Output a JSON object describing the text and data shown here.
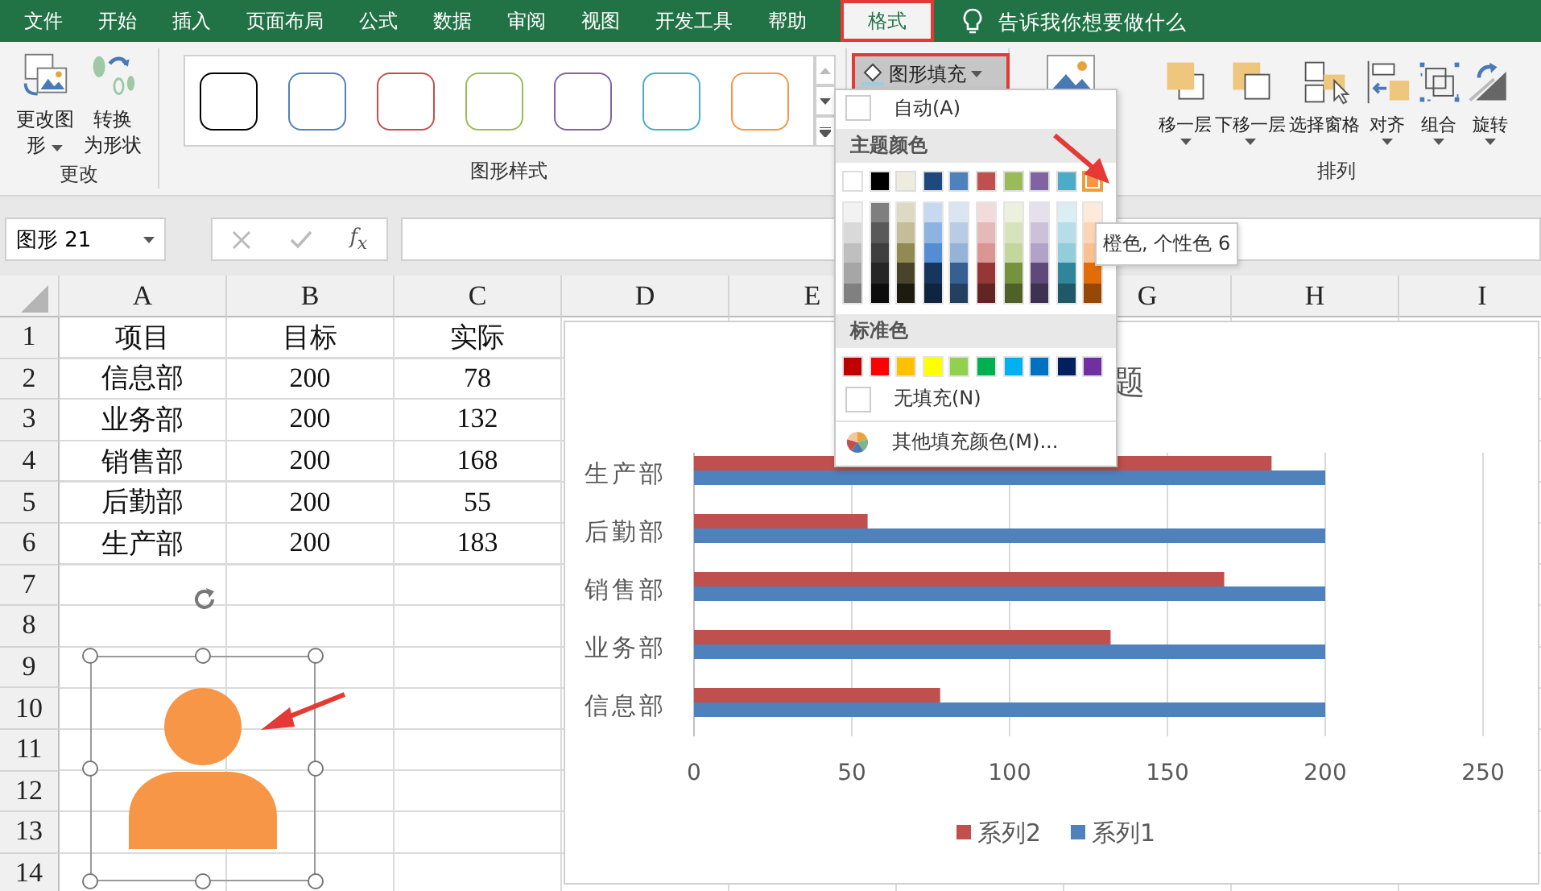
{
  "menu_tabs": [
    {
      "label": "文件",
      "selected": false
    },
    {
      "label": "开始",
      "selected": false
    },
    {
      "label": "插入",
      "selected": false
    },
    {
      "label": "页面布局",
      "selected": false
    },
    {
      "label": "公式",
      "selected": false
    },
    {
      "label": "数据",
      "selected": false
    },
    {
      "label": "审阅",
      "selected": false
    },
    {
      "label": "视图",
      "selected": false
    },
    {
      "label": "开发工具",
      "selected": false
    },
    {
      "label": "帮助",
      "selected": false
    },
    {
      "label": "格式",
      "selected": true
    }
  ],
  "tell_me": {
    "placeholder": "告诉我你想要做什么"
  },
  "ribbon": {
    "change_group": {
      "label": "更改",
      "buttons": [
        {
          "kind": "change",
          "lines": [
            "更改图",
            "形"
          ],
          "dropdown": true
        },
        {
          "kind": "convert",
          "lines": [
            "转换",
            "为形状"
          ],
          "dropdown": false
        }
      ]
    },
    "styles_group": {
      "label": "图形样式",
      "styles": [
        {
          "color": "#000000"
        },
        {
          "color": "#4f81bd"
        },
        {
          "color": "#c0504d"
        },
        {
          "color": "#9bbb59"
        },
        {
          "color": "#8064a2"
        },
        {
          "color": "#4bacc6"
        },
        {
          "color": "#f79646"
        }
      ]
    },
    "fill_button": {
      "label": "图形填充",
      "expanded": true
    },
    "arrange_group": {
      "label": "排列",
      "buttons": [
        {
          "kind": "forward",
          "label": "移一层",
          "dropdown": true
        },
        {
          "kind": "backward",
          "label": "下移一层",
          "dropdown": true
        },
        {
          "kind": "pane",
          "label": "选择窗格",
          "dropdown": false
        },
        {
          "kind": "align",
          "label": "对齐",
          "dropdown": true
        },
        {
          "kind": "group",
          "label": "组合",
          "dropdown": true
        },
        {
          "kind": "rotate",
          "label": "旋转",
          "dropdown": true
        }
      ]
    }
  },
  "formula_bar": {
    "name_box": "图形 21",
    "fx": "f$_{x}$"
  },
  "sheet": {
    "columns": [
      {
        "label": "A"
      },
      {
        "label": "B"
      },
      {
        "label": "C"
      },
      {
        "label": "D"
      },
      {
        "label": "E"
      },
      {},
      {
        "label": "G"
      },
      {
        "label": "H"
      },
      {
        "label": "I"
      }
    ],
    "rows": [
      "1",
      "2",
      "3",
      "4",
      "5",
      "6",
      "7",
      "8",
      "9",
      "10",
      "11",
      "12",
      "13",
      "14"
    ],
    "cells": [
      [
        "项目",
        "目标",
        "实际"
      ],
      [
        "信息部",
        "200",
        "78"
      ],
      [
        "业务部",
        "200",
        "132"
      ],
      [
        "销售部",
        "200",
        "168"
      ],
      [
        "后勤部",
        "200",
        "55"
      ],
      [
        "生产部",
        "200",
        "183"
      ]
    ]
  },
  "chart": {
    "title": "题",
    "chart_data": {
      "type": "bar",
      "orientation": "horizontal",
      "categories": [
        "生产部",
        "后勤部",
        "销售部",
        "业务部",
        "信息部"
      ],
      "series": [
        {
          "name": "系列1",
          "color": "#4f81bd",
          "values": [
            200,
            200,
            200,
            200,
            200
          ]
        },
        {
          "name": "系列2",
          "color": "#c0504d",
          "values": [
            183,
            55,
            168,
            132,
            78
          ]
        }
      ],
      "xlim": [
        0,
        250
      ],
      "xticks": [
        0,
        50,
        100,
        150,
        200,
        250
      ],
      "grid": true,
      "legend": "bottom"
    }
  },
  "shape": {
    "kind": "person",
    "color": "#f79646",
    "selected": true
  },
  "dropdown": {
    "auto": "自动(A)",
    "theme_header": "主题颜色",
    "theme_colors": [
      {
        "color": "#ffffff",
        "selected": false,
        "shades": [
          {
            "color": "#f2f2f2"
          },
          {
            "color": "#d9d9d9"
          },
          {
            "color": "#bfbfbf"
          },
          {
            "color": "#a6a6a6"
          },
          {
            "color": "#808080"
          }
        ]
      },
      {
        "color": "#000000",
        "selected": false,
        "shades": [
          {
            "color": "#7f7f7f"
          },
          {
            "color": "#595959"
          },
          {
            "color": "#3f3f3f"
          },
          {
            "color": "#262626"
          },
          {
            "color": "#0d0d0d"
          }
        ]
      },
      {
        "color": "#eeece1",
        "selected": false,
        "shades": [
          {
            "color": "#ddd9c3"
          },
          {
            "color": "#c4bd97"
          },
          {
            "color": "#938953"
          },
          {
            "color": "#494429"
          },
          {
            "color": "#1d1b10"
          }
        ]
      },
      {
        "color": "#1f497d",
        "selected": false,
        "shades": [
          {
            "color": "#c6d9f0"
          },
          {
            "color": "#8db3e2"
          },
          {
            "color": "#548dd4"
          },
          {
            "color": "#17365d"
          },
          {
            "color": "#0f243e"
          }
        ]
      },
      {
        "color": "#4f81bd",
        "selected": false,
        "shades": [
          {
            "color": "#dbe5f1"
          },
          {
            "color": "#b8cce4"
          },
          {
            "color": "#95b3d7"
          },
          {
            "color": "#366092"
          },
          {
            "color": "#244061"
          }
        ]
      },
      {
        "color": "#c0504d",
        "selected": false,
        "shades": [
          {
            "color": "#f2dcdb"
          },
          {
            "color": "#e5b9b7"
          },
          {
            "color": "#d99694"
          },
          {
            "color": "#953734"
          },
          {
            "color": "#632423"
          }
        ]
      },
      {
        "color": "#9bbb59",
        "selected": false,
        "shades": [
          {
            "color": "#ebf1dd"
          },
          {
            "color": "#d7e3bc"
          },
          {
            "color": "#c3d69b"
          },
          {
            "color": "#76923c"
          },
          {
            "color": "#4f6128"
          }
        ]
      },
      {
        "color": "#8064a2",
        "selected": false,
        "shades": [
          {
            "color": "#e5e0ec"
          },
          {
            "color": "#ccc1d9"
          },
          {
            "color": "#b2a2c7"
          },
          {
            "color": "#5f497a"
          },
          {
            "color": "#3f3151"
          }
        ]
      },
      {
        "color": "#4bacc6",
        "selected": false,
        "shades": [
          {
            "color": "#dbeef3"
          },
          {
            "color": "#b7dde8"
          },
          {
            "color": "#92cddc"
          },
          {
            "color": "#31859b"
          },
          {
            "color": "#205867"
          }
        ]
      },
      {
        "color": "#f79646",
        "selected": true,
        "shades": [
          {
            "color": "#fdeada"
          },
          {
            "color": "#fbd5b5"
          },
          {
            "color": "#fac08f"
          },
          {
            "color": "#e36c09"
          },
          {
            "color": "#974806"
          }
        ]
      }
    ],
    "standard_header": "标准色",
    "standard_colors": [
      {
        "color": "#c00000"
      },
      {
        "color": "#ff0000"
      },
      {
        "color": "#ffc000"
      },
      {
        "color": "#ffff00"
      },
      {
        "color": "#92d050"
      },
      {
        "color": "#00b050"
      },
      {
        "color": "#00b0f0"
      },
      {
        "color": "#0070c0"
      },
      {
        "color": "#002060"
      },
      {
        "color": "#7030a0"
      }
    ],
    "no_fill": "无填充(N)",
    "more": "其他填充颜色(M)..."
  },
  "tooltip": "橙色, 个性色 6"
}
